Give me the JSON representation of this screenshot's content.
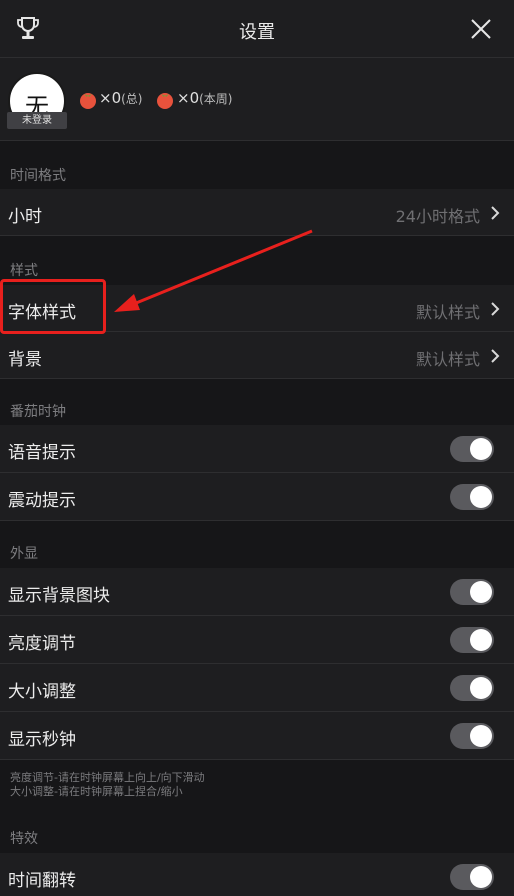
{
  "header": {
    "title": "设置"
  },
  "profile": {
    "avatar_char": "无",
    "login_badge": "未登录",
    "total_count": "×0",
    "total_suffix": "(总)",
    "week_count": "×0",
    "week_suffix": "(本周)"
  },
  "sections": {
    "time_format": "时间格式",
    "style": "样式",
    "pomodoro": "番茄时钟",
    "display": "外显",
    "effects": "特效"
  },
  "rows": {
    "hour": {
      "label": "小时",
      "value": "24小时格式"
    },
    "font_style": {
      "label": "字体样式",
      "value": "默认样式"
    },
    "background": {
      "label": "背景",
      "value": "默认样式"
    },
    "voice": {
      "label": "语音提示",
      "on": true
    },
    "vibrate": {
      "label": "震动提示",
      "on": true
    },
    "show_bg_blocks": {
      "label": "显示背景图块",
      "on": true
    },
    "brightness": {
      "label": "亮度调节",
      "on": true
    },
    "size": {
      "label": "大小调整",
      "on": true
    },
    "seconds": {
      "label": "显示秒钟",
      "on": true
    },
    "flip": {
      "label": "时间翻转",
      "on": true
    }
  },
  "note": {
    "line1": "亮度调节-请在时钟屏幕上向上/向下滑动",
    "line2": "大小调整-请在时钟屏幕上捏合/缩小"
  },
  "colors": {
    "highlight": "#e8201d",
    "toggle_track": "#5a5a5e",
    "tomato": "#e8523c"
  }
}
